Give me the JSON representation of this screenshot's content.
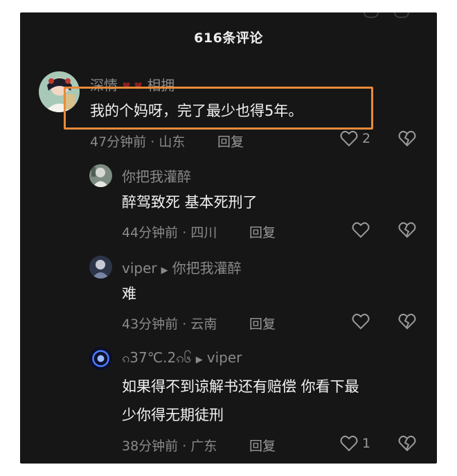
{
  "header": {
    "title": "616条评论"
  },
  "comments": [
    {
      "username": "深情",
      "username_suffix": "相拥",
      "text": "我的个妈呀，完了最少也得5年。",
      "time": "47分钟前",
      "location": "山东",
      "reply_label": "回复",
      "likes": "2"
    },
    {
      "username": "你把我灌醉",
      "text": "醉驾致死 基本死刑了",
      "time": "44分钟前",
      "location": "四川",
      "reply_label": "回复",
      "likes": ""
    },
    {
      "username": "viper",
      "reply_to": "你把我灌醉",
      "text": "难",
      "time": "43分钟前",
      "location": "云南",
      "reply_label": "回复",
      "likes": ""
    },
    {
      "username": "ၵ37℃.2ၵ၆",
      "reply_to": "viper",
      "text_line1": "如果得不到谅解书还有赔偿 你看下最",
      "text_line2": "少你得无期徒刑",
      "time": "38分钟前",
      "location": "广东",
      "reply_label": "回复",
      "likes": "1"
    }
  ],
  "meta_separator": " · ",
  "colors": {
    "background": "#161616",
    "highlight": "#e98a3a",
    "muted": "#8a8a8a"
  },
  "icons": [
    "heart-outline-icon",
    "broken-heart-icon",
    "red-heart-icon",
    "reply-arrow-icon"
  ]
}
